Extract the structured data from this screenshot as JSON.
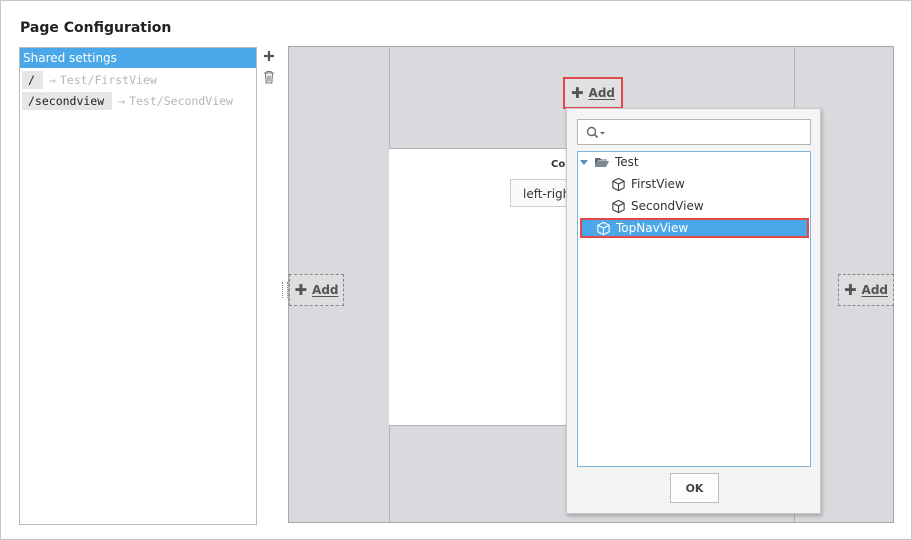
{
  "page": {
    "title": "Page Configuration"
  },
  "routes": {
    "header": "Shared settings",
    "items": [
      {
        "path": "/",
        "view": "Test/FirstView"
      },
      {
        "path": "/secondview",
        "view": "Test/SecondView"
      }
    ]
  },
  "toolbar": {
    "add_icon": "plus-icon",
    "delete_icon": "trash-icon"
  },
  "layout": {
    "add_label": "Add",
    "center_label": "Co",
    "center_select": "left-righ"
  },
  "popup": {
    "search_placeholder": "",
    "tree": {
      "folder": "Test",
      "children": [
        "FirstView",
        "SecondView"
      ],
      "root_item": "TopNavView"
    },
    "ok_label": "OK"
  },
  "colors": {
    "selection": "#4aa8e8",
    "highlight": "#e2474b"
  }
}
